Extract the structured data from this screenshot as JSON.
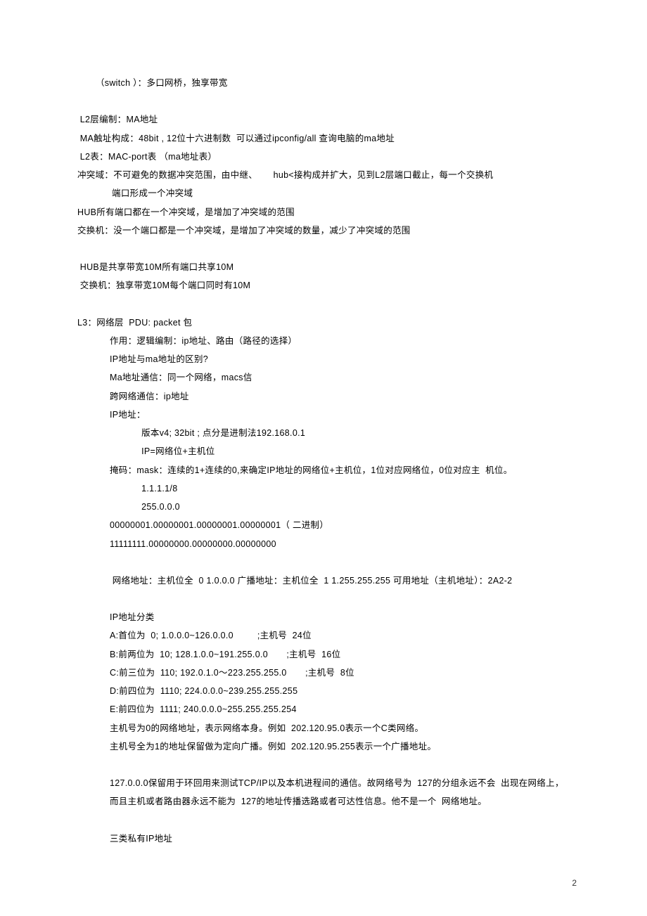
{
  "pageNumber": "2",
  "lines": [
    {
      "cls": "indent4",
      "t": "（switch ）：多口网桥，独享带宽"
    },
    {
      "cls": "blank",
      "t": ""
    },
    {
      "cls": "indent1",
      "t": " L2层编制：MA地址"
    },
    {
      "cls": "indent1",
      "t": " MA触址构成：48bit , 12位十六进制数  可以通过ipconfig/all 查询电脑的ma地址"
    },
    {
      "cls": "indent1",
      "t": " L2表：MAC-port表 （ma地址表）"
    },
    {
      "cls": "indent1",
      "t": "冲突域：不可避免的数据冲突范围，由中继、      hub<接构成并扩大，见到L2层端口截止，每一个交换机"
    },
    {
      "cls": "indent1",
      "t": "             端口形成一个冲突域"
    },
    {
      "cls": "indent1",
      "t": "HUB所有端口都在一个冲突域，是增加了冲突域的范围"
    },
    {
      "cls": "indent1",
      "t": "交换机：没一个端口都是一个冲突域，是增加了冲突域的数量，减少了冲突域的范围"
    },
    {
      "cls": "blank",
      "t": ""
    },
    {
      "cls": "indent1",
      "t": " HUB是共享带宽10M所有端口共享10M"
    },
    {
      "cls": "indent1",
      "t": " 交换机：独享带宽10M每个端口同时有10M"
    },
    {
      "cls": "blank",
      "t": ""
    },
    {
      "cls": "indent1",
      "t": "L3：网络层  PDU: packet 包"
    },
    {
      "cls": "indent2",
      "t": "作用：逻辑编制：ip地址、路由（路径的选择）"
    },
    {
      "cls": "indent2",
      "t": "IP地址与ma地址的区别?"
    },
    {
      "cls": "indent2",
      "t": "Ma地址通信：同一个网络，macs信"
    },
    {
      "cls": "indent2",
      "t": "跨网络通信：ip地址"
    },
    {
      "cls": "indent2",
      "t": "IP地址："
    },
    {
      "cls": "indent3",
      "t": "    版本v4; 32bit ; 点分是进制法192.168.0.1"
    },
    {
      "cls": "indent3",
      "t": "    IP=网络位+主机位"
    },
    {
      "cls": "indent2",
      "t": "掩码：mask：连续的1+连续的0,来确定IP地址的网络位+主机位，1位对应网络位，0位对应主  机位。"
    },
    {
      "cls": "indent3",
      "t": "    1.1.1.1/8"
    },
    {
      "cls": "indent3",
      "t": "    255.0.0.0"
    },
    {
      "cls": "indent2",
      "t": "00000001.00000001.00000001.00000001（ 二进制）"
    },
    {
      "cls": "indent2",
      "t": "11111111.00000000.00000000.00000000"
    },
    {
      "cls": "blank",
      "t": ""
    },
    {
      "cls": "indent2",
      "t": " 网络地址：主机位全  0 1.0.0.0 广播地址：主机位全  1 1.255.255.255 可用地址（主机地址）：2A2-2"
    },
    {
      "cls": "blank",
      "t": ""
    },
    {
      "cls": "indent2",
      "t": "IP地址分类"
    },
    {
      "cls": "indent2",
      "t": "A:首位为  0; 1.0.0.0~126.0.0.0         ;主机号  24位"
    },
    {
      "cls": "indent2",
      "t": "B:前两位为  10; 128.1.0.0~191.255.0.0       ;主机号  16位"
    },
    {
      "cls": "indent2",
      "t": "C:前三位为  110; 192.0.1.0～223.255.255.0       ;主机号  8位"
    },
    {
      "cls": "indent2",
      "t": "D:前四位为  1110; 224.0.0.0~239.255.255.255"
    },
    {
      "cls": "indent2",
      "t": "E:前四位为  1111; 240.0.0.0~255.255.255.254"
    },
    {
      "cls": "indent2",
      "t": "主机号为0的网络地址，表示网络本身。例如  202.120.95.0表示一个C类网络。"
    },
    {
      "cls": "indent2",
      "t": "主机号全为1的地址保留做为定向广播。例如  202.120.95.255表示一个广播地址。"
    },
    {
      "cls": "blank",
      "t": ""
    },
    {
      "cls": "indent2",
      "t": "127.0.0.0保留用于环回用来测试TCP/IP以及本机进程间的通信。故网络号为  127的分组永远不会  出现在网络上，"
    },
    {
      "cls": "indent2",
      "t": "而且主机或者路由器永远不能为  127的地址传播选路或者可达性信息。他不是一个  网络地址。"
    },
    {
      "cls": "blank",
      "t": ""
    },
    {
      "cls": "indent2",
      "t": "三类私有IP地址"
    }
  ]
}
